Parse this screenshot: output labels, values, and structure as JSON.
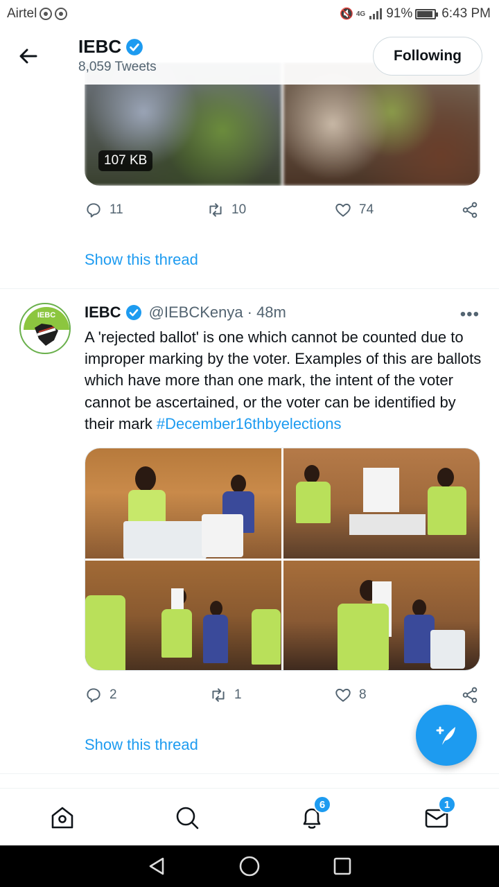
{
  "status_bar": {
    "carrier": "Airtel",
    "network": "4G",
    "battery": "91%",
    "time": "6:43 PM"
  },
  "header": {
    "title": "IEBC",
    "subtitle": "8,059 Tweets",
    "follow_label": "Following"
  },
  "prev_tweet": {
    "media_size": "107 KB",
    "replies": "11",
    "retweets": "10",
    "likes": "74",
    "show_thread": "Show this thread"
  },
  "tweet": {
    "name": "IEBC",
    "handle": "@IEBCKenya",
    "time": "· 48m",
    "more": "•••",
    "text": "A 'rejected ballot' is one which cannot be counted due to improper marking by the voter. Examples of this are ballots which have more than one mark, the intent of the voter cannot be ascertained, or the voter can be identified by their mark ",
    "hashtag": "#December16thbyelections",
    "avatar_text": "IEBC",
    "replies": "2",
    "retweets": "1",
    "likes": "8",
    "show_thread": "Show this thread"
  },
  "bottom_nav": {
    "notifications_badge": "6",
    "messages_badge": "1"
  },
  "colors": {
    "accent": "#1d9bf0",
    "text": "#0f1419",
    "secondary": "#536471"
  }
}
